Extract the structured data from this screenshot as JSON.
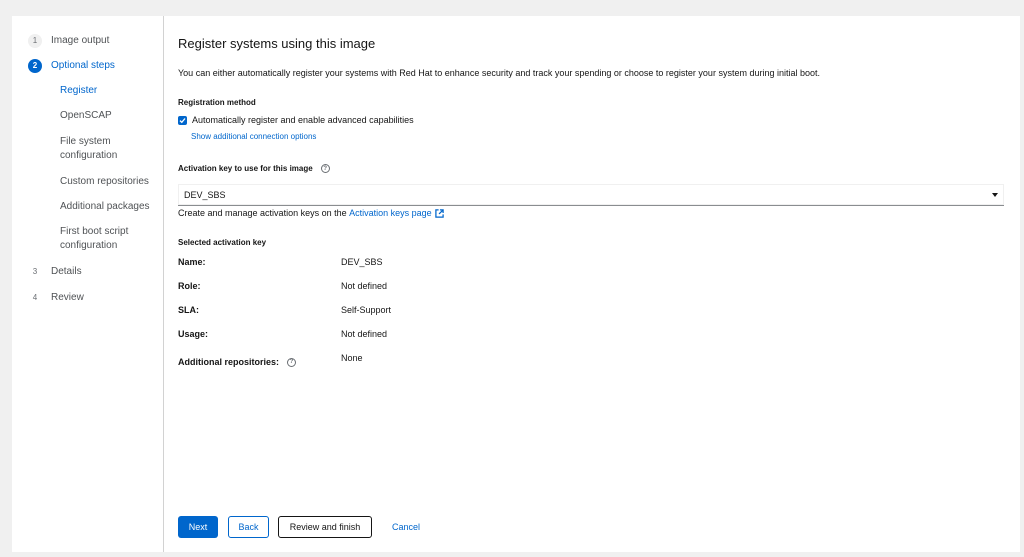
{
  "nav": {
    "steps": [
      {
        "num": "1",
        "label": "Image output"
      },
      {
        "num": "2",
        "label": "Optional steps"
      },
      {
        "num": "3",
        "label": "Details"
      },
      {
        "num": "4",
        "label": "Review"
      }
    ],
    "substeps": [
      {
        "label": "Register"
      },
      {
        "label": "OpenSCAP"
      },
      {
        "label": "File system configuration"
      },
      {
        "label": "Custom repositories"
      },
      {
        "label": "Additional packages"
      },
      {
        "label": "First boot script configuration"
      }
    ]
  },
  "main": {
    "title": "Register systems using this image",
    "description": "You can either automatically register your systems with Red Hat to enhance security and track your spending or choose to register your system during initial boot.",
    "registration_method_label": "Registration method",
    "auto_register_label": "Automatically register and enable advanced capabilities",
    "auto_register_checked": true,
    "show_options_link": "Show additional connection options",
    "activation_key_label": "Activation key to use for this image",
    "activation_key_value": "DEV_SBS",
    "helper_text": "Create and manage activation keys on the",
    "helper_link": "Activation keys page",
    "selected_key_label": "Selected activation key",
    "details": [
      {
        "key": "Name:",
        "value": "DEV_SBS"
      },
      {
        "key": "Role:",
        "value": "Not defined"
      },
      {
        "key": "SLA:",
        "value": "Self-Support"
      },
      {
        "key": "Usage:",
        "value": "Not defined"
      },
      {
        "key": "Additional repositories:",
        "value": "None"
      }
    ]
  },
  "footer": {
    "next": "Next",
    "back": "Back",
    "review_finish": "Review and finish",
    "cancel": "Cancel"
  },
  "colors": {
    "accent": "#0066cc",
    "text": "#151515",
    "muted": "#4f5255"
  }
}
